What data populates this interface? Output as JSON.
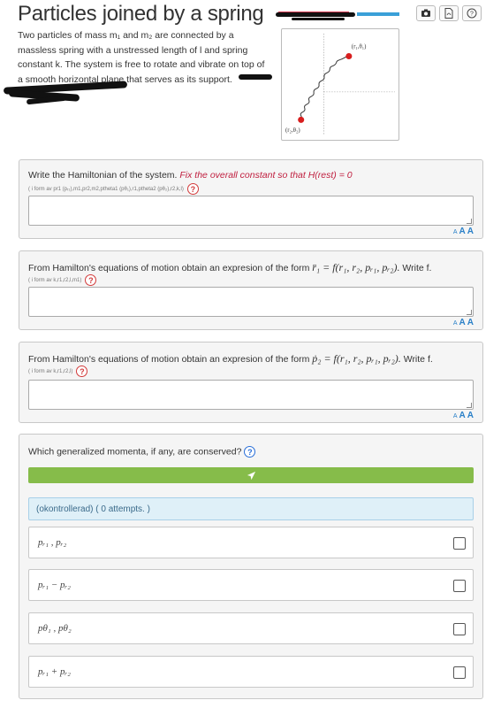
{
  "header": {
    "title": "Particles joined by a spring",
    "icons": [
      "camera-icon",
      "pdf-icon",
      "help-icon"
    ]
  },
  "intro": {
    "line1": "Two particles of mass m₁ and m₂ are connected by a",
    "line2": "massless spring with a unstressed length of l and spring",
    "line3": "constant k. The system is free to rotate and vibrate on top of",
    "line4": "a smooth horizontal plane that serves as its support."
  },
  "figure": {
    "label_top": "(r₁,θ₁)",
    "label_bottom": "(r₂,θ₂)"
  },
  "questions": [
    {
      "prompt": "Write the Hamiltonian of the system.",
      "prompt_highlight": "Fix the overall constant so that H(rest) = 0",
      "hint": "( i form av pr1 (pᵣ₁),m1,pr2,m2,ptheta1 (pθ₁),r1,ptheta2 (pθ₂),r2,k,l)",
      "answer_value": ""
    },
    {
      "prompt": "From Hamilton's equations of motion obtain an expresion of the form",
      "prompt_math": "r̈₁ = f(r₁, r₂, pᵣ₁, pᵣ₂).",
      "prompt_tail": "Write f.",
      "hint": "( i form av k,r1,r2,l,m1)",
      "answer_value": ""
    },
    {
      "prompt": "From Hamilton's equations of motion obtain an expresion of the form",
      "prompt_math": "ṗ₂ = f(r₁, r₂, pᵣ₁, pᵣ₂).",
      "prompt_tail": "Write f.",
      "hint": "( i form av k,r1,r2,l)",
      "answer_value": ""
    }
  ],
  "font_controls": {
    "small": "A",
    "medium": "A",
    "large": "A"
  },
  "multiple_choice": {
    "prompt": "Which generalized momenta, if any, are conserved?",
    "status": "(okontrollerad) ( 0 attempts. )",
    "options": [
      {
        "label": "pᵣ₁ , pᵣ₂",
        "checked": false
      },
      {
        "label": "pᵣ₁ − pᵣ₂",
        "checked": false
      },
      {
        "label": "pθ₁ , pθ₂",
        "checked": false
      },
      {
        "label": "pᵣ₁ + pᵣ₂",
        "checked": false
      }
    ]
  },
  "colors": {
    "submit_green": "#86bc4a",
    "highlight_red": "#c02040",
    "help_red": "#d23a3a",
    "help_blue": "#2a6fd8",
    "status_bg": "#dff0f8"
  }
}
